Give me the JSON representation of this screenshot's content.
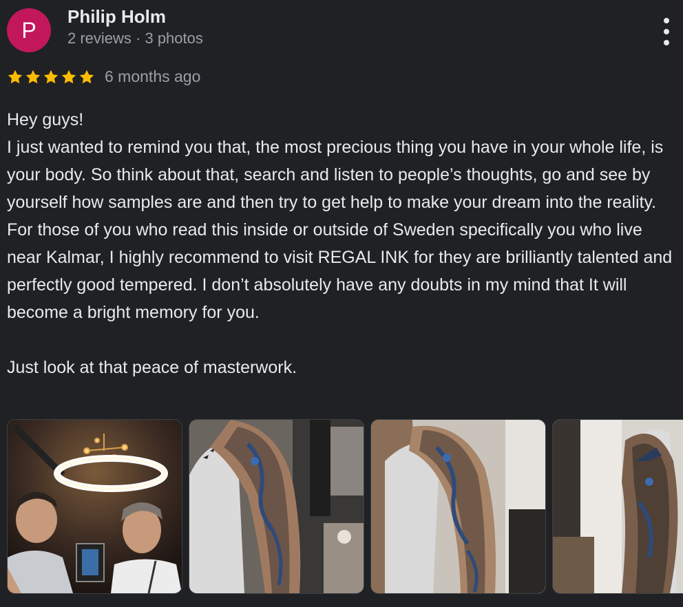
{
  "review": {
    "author": {
      "name": "Philip Holm",
      "initial": "P",
      "meta": "2 reviews · 3 photos",
      "avatar_color": "#c2185b"
    },
    "rating": {
      "value": 5,
      "max": 5,
      "star_color": "#fbbc04"
    },
    "time": "6 months ago",
    "text": "Hey guys!\nI just wanted to remind you that, the most precious thing you have in your whole life, is your body. So think about that, search and listen to people’s thoughts, go and see by yourself how samples are and then try to get help to make your dream into the reality. For those of you who read this inside or outside of Sweden specifically you who live near Kalmar, I highly recommend to visit REGAL INK for they are brilliantly talented and perfectly good tempered. I don’t absolutely have any doubts in my mind that It will become a bright memory for you.\n\nJust look at that peace of masterwork.",
    "more_icon": "more-vert-icon"
  },
  "theme": {
    "background": "#202124",
    "text_primary": "#e8eaed",
    "text_secondary": "#9aa0a6"
  }
}
